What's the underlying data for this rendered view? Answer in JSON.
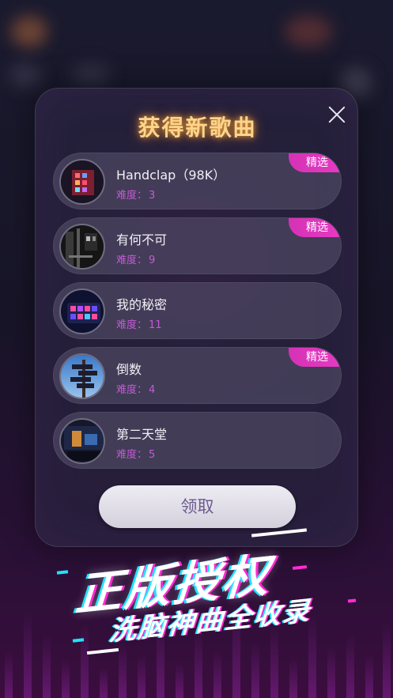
{
  "dialog": {
    "title": "获得新歌曲",
    "close_icon": "close-icon",
    "claim_label": "领取"
  },
  "difficulty_label": "难度：",
  "songs": [
    {
      "name": "Handclap（98K）",
      "difficulty": "3",
      "badge": "精选",
      "cover_icon": "album-cover"
    },
    {
      "name": "有何不可",
      "difficulty": "9",
      "badge": "精选",
      "cover_icon": "album-cover"
    },
    {
      "name": "我的秘密",
      "difficulty": "11",
      "badge": "",
      "cover_icon": "album-cover"
    },
    {
      "name": "倒数",
      "difficulty": "4",
      "badge": "精选",
      "cover_icon": "album-cover"
    },
    {
      "name": "第二天堂",
      "difficulty": "5",
      "badge": "",
      "cover_icon": "album-cover"
    }
  ],
  "slogan": {
    "main": "正版授权",
    "sub": "洗脑神曲全收录"
  },
  "colors": {
    "title_glow": "#fbd58b",
    "badge": "#e03abd",
    "difficulty": "#c45ad6",
    "glitch_cyan": "#21e2ff",
    "glitch_magenta": "#ff2bd3"
  }
}
